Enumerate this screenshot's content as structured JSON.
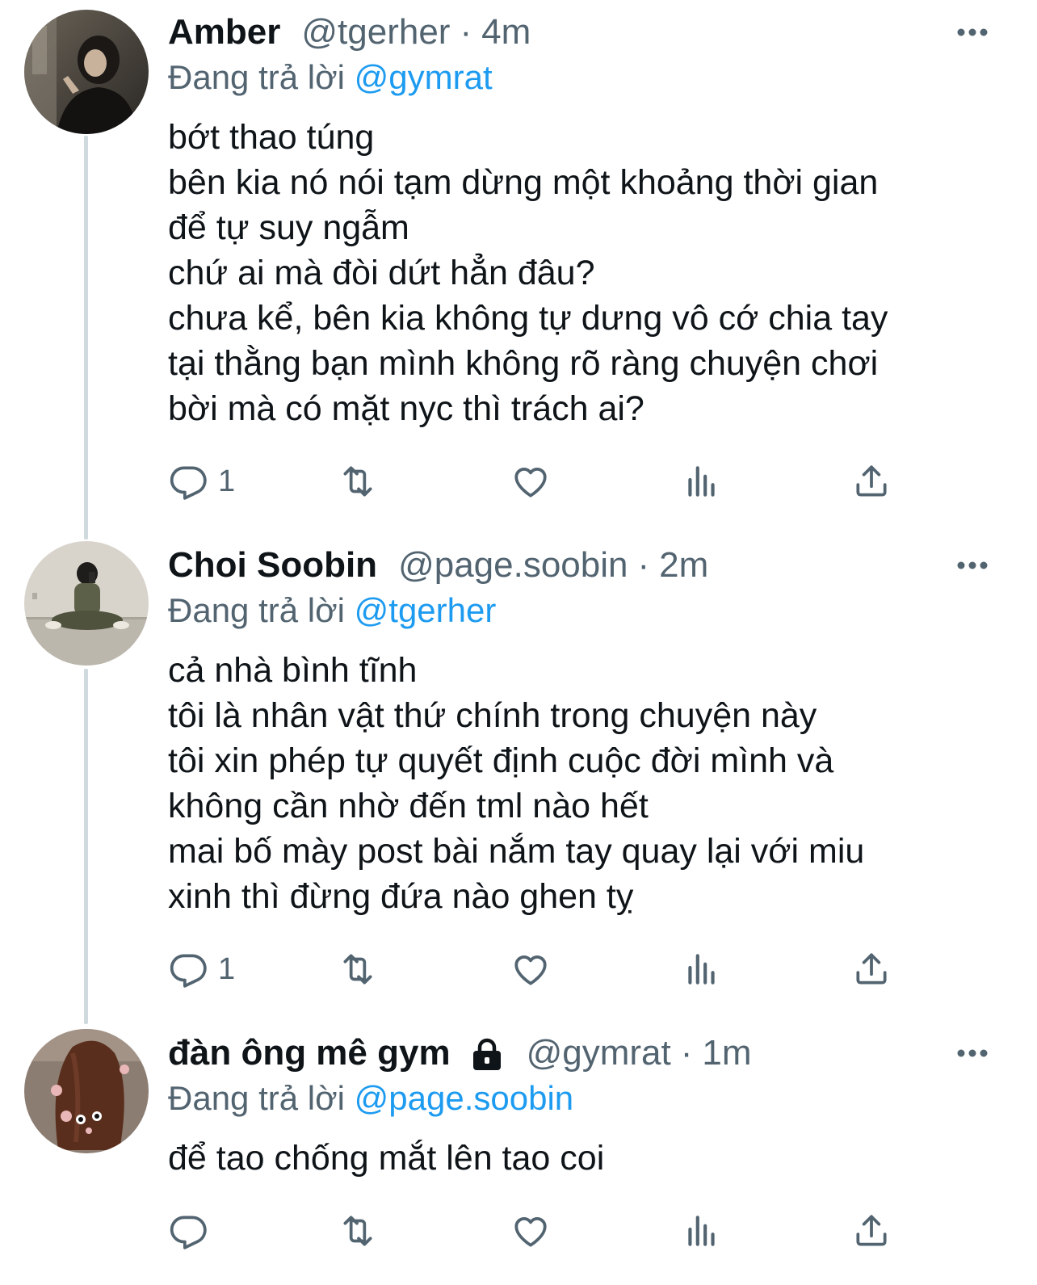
{
  "tweets": [
    {
      "name": "Amber",
      "handle": "@tgerher",
      "dot": "·",
      "time": "4m",
      "reply_prefix": "Đang trả lời",
      "reply_mention": "@gymrat",
      "lines": [
        "bớt thao túng",
        "bên kia nó nói tạm dừng một khoảng thời gian",
        "để tự suy ngẫm",
        "chứ ai mà đòi dứt hẳn đâu?",
        "chưa kể, bên kia không tự dưng vô cớ chia tay",
        "tại thằng bạn mình không rõ ràng chuyện chơi",
        "bời mà có mặt nyc thì trách ai?"
      ],
      "reply_count": "1",
      "locked": false
    },
    {
      "name": "Choi Soobin",
      "handle": "@page.soobin",
      "dot": "·",
      "time": "2m",
      "reply_prefix": "Đang trả lời",
      "reply_mention": "@tgerher",
      "lines": [
        "cả nhà bình tĩnh",
        "tôi là nhân vật thứ chính trong chuyện này",
        "tôi xin phép tự quyết định cuộc đời mình và",
        "không cần nhờ đến tml nào hết",
        "mai bố mày post bài nắm tay quay lại với miu",
        "xinh thì đừng đứa nào ghen tỵ"
      ],
      "reply_count": "1",
      "locked": false
    },
    {
      "name": "đàn ông mê gym",
      "handle": "@gymrat",
      "dot": "·",
      "time": "1m",
      "reply_prefix": "Đang trả lời",
      "reply_mention": "@page.soobin",
      "lines": [
        "để tao chống mắt lên tao coi"
      ],
      "reply_count": "",
      "locked": true
    }
  ],
  "colors": {
    "text": "#0f1419",
    "secondary": "#536471",
    "accent": "#1d9bf0",
    "thread_line": "#cfd9de"
  },
  "icons": [
    "reply-icon",
    "retweet-icon",
    "like-icon",
    "views-icon",
    "share-icon",
    "more-icon",
    "lock-icon"
  ]
}
